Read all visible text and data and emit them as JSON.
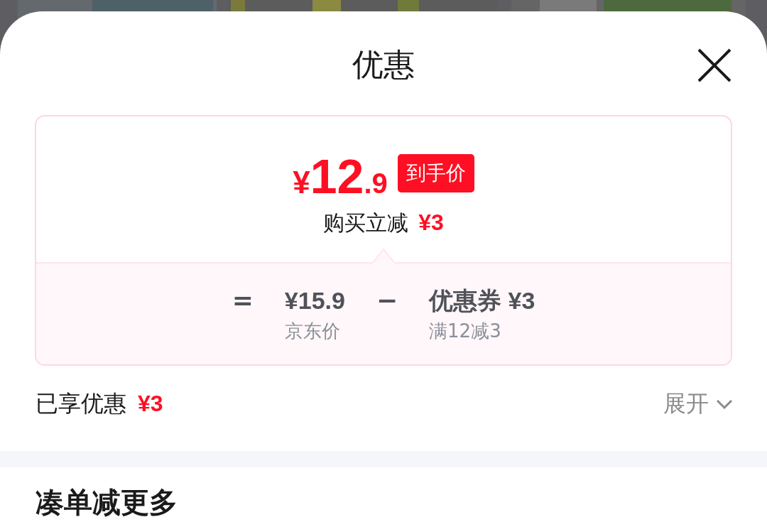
{
  "sheet": {
    "title": "优惠"
  },
  "price_card": {
    "final_price": {
      "currency": "¥",
      "integer": "12",
      "decimal": ".9"
    },
    "badge": "到手价",
    "saving": {
      "label": "购买立减",
      "amount": "¥3"
    },
    "breakdown": [
      {
        "kind": "operator",
        "symbol": "="
      },
      {
        "kind": "term",
        "value": "¥15.9",
        "caption": "京东价"
      },
      {
        "kind": "operator",
        "symbol": "−"
      },
      {
        "kind": "term",
        "value": "优惠券 ¥3",
        "caption": "满12减3"
      }
    ]
  },
  "enjoyed": {
    "label": "已享优惠",
    "amount": "¥3",
    "toggle": "展开",
    "expanded": false
  },
  "next_section": {
    "title": "凑单减更多"
  }
}
